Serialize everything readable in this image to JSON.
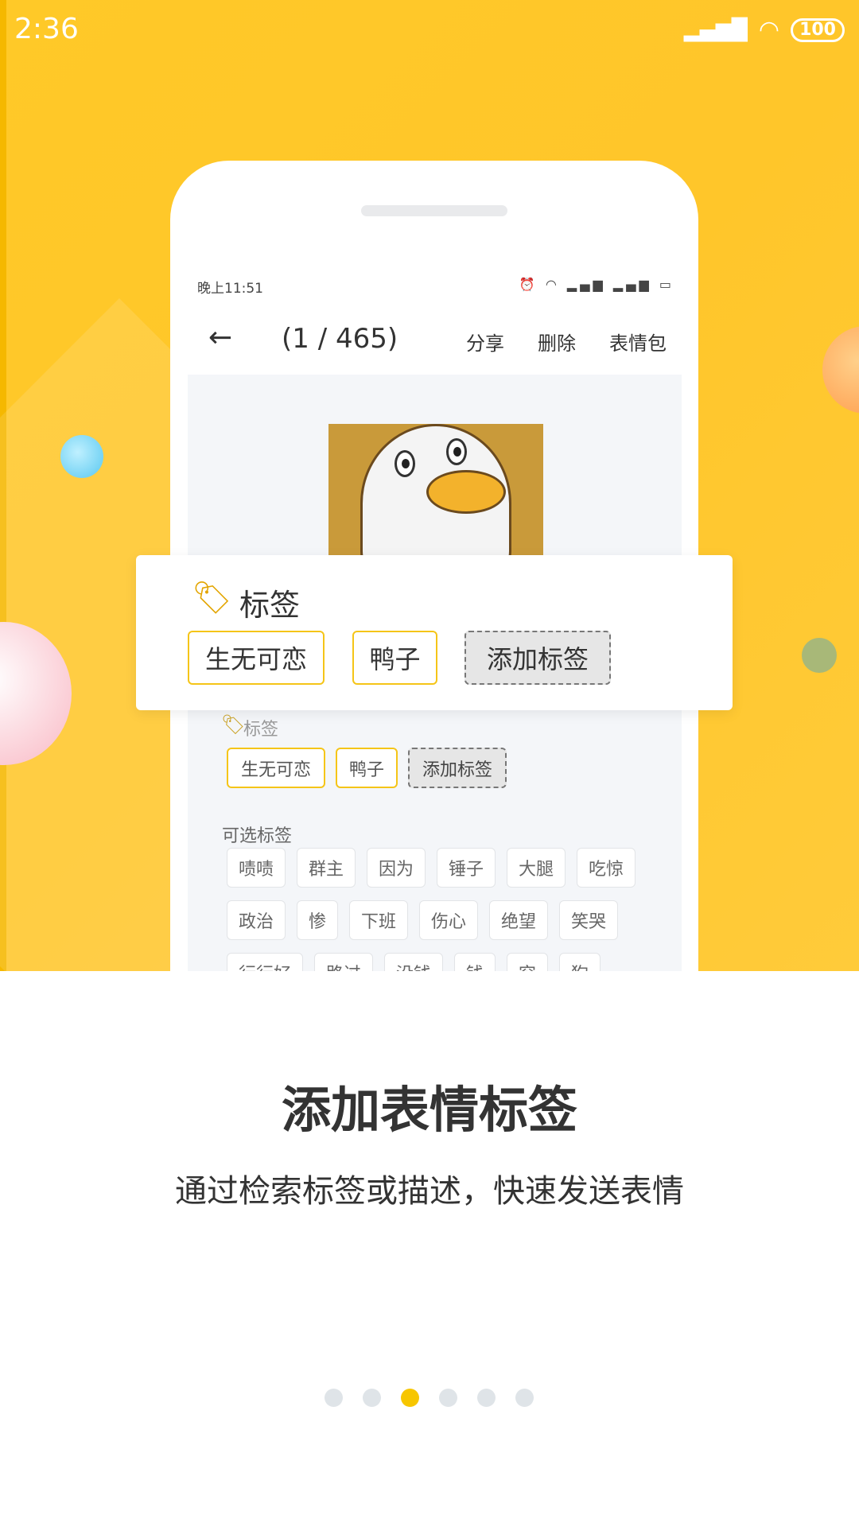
{
  "status_bar": {
    "time": "2:36",
    "battery": "100"
  },
  "phone": {
    "status_time": "晚上11:51",
    "toolbar": {
      "back": "←",
      "counter": "(1 / 465)",
      "share": "分享",
      "delete": "删除",
      "sticker_pack": "表情包"
    },
    "tags_label": "标签",
    "tags": [
      "生无可恋",
      "鸭子"
    ],
    "add_tag": "添加标签",
    "optional_label": "可选标签",
    "optional_tags": [
      [
        "啧啧",
        "群主",
        "因为",
        "锤子",
        "大腿",
        "吃惊"
      ],
      [
        "政治",
        "惨",
        "下班",
        "伤心",
        "绝望",
        "笑哭"
      ],
      [
        "行行好",
        "路过",
        "没钱",
        "钱",
        "穷",
        "狗"
      ]
    ]
  },
  "card": {
    "label": "标签",
    "tags": [
      "生无可恋",
      "鸭子"
    ],
    "add_tag": "添加标签"
  },
  "onboarding": {
    "title": "添加表情标签",
    "subtitle": "通过检索标签或描述，快速发送表情",
    "page_count": 6,
    "active_page": 3
  },
  "colors": {
    "background": "#ffc928",
    "accent": "#f7c600",
    "chip_border": "#f5c518"
  }
}
